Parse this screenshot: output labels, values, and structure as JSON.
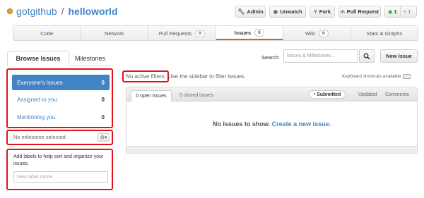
{
  "repo": {
    "owner": "gotgithub",
    "separator": "/",
    "name": "helloworld",
    "icon": "repo-icon"
  },
  "header_buttons": {
    "admin": {
      "label": "Admin",
      "icon": "wrench-icon"
    },
    "unwatch": {
      "label": "Unwatch",
      "icon": "eye-icon"
    },
    "fork": {
      "label": "Fork",
      "icon": "fork-icon"
    },
    "pull_request": {
      "label": "Pull Request",
      "icon": "pull-request-icon"
    },
    "watchers": {
      "count": "1",
      "icon": "eye-icon"
    },
    "forks": {
      "count": "1",
      "icon": "fork-icon"
    }
  },
  "tabs": [
    {
      "label": "Code",
      "badge": ""
    },
    {
      "label": "Network",
      "badge": ""
    },
    {
      "label": "Pull Requests",
      "badge": "0"
    },
    {
      "label": "Issues",
      "badge": "0"
    },
    {
      "label": "Wiki",
      "badge": "0"
    },
    {
      "label": "Stats & Graphs",
      "badge": ""
    }
  ],
  "active_tab": "Issues",
  "subnav": {
    "browse_label": "Browse Issues",
    "milestones_label": "Milestones",
    "search_label": "Search:",
    "search_placeholder": "Issues & Milestones...",
    "new_issue_label": "New Issue"
  },
  "sidebar": {
    "filters": [
      {
        "label": "Everyone's Issues",
        "count": "0",
        "selected": true
      },
      {
        "label": "Assigned to you",
        "count": "0",
        "selected": false
      },
      {
        "label": "Mentioning you",
        "count": "0",
        "selected": false
      }
    ],
    "milestone_label": "No milestone selected",
    "labels_help": "Add labels to help sort and organize your issues.",
    "label_placeholder": "New label name"
  },
  "main": {
    "filters_status": "No active filters.",
    "filters_hint": "Use the sidebar to filter issues.",
    "keyboard_hint": "Keyboard shortcuts available",
    "open_tab": "0 open issues",
    "closed_tab": "0 closed issues",
    "sort_options": [
      "Submitted",
      "Updated",
      "Comments"
    ],
    "empty_text": "No issues to show.",
    "empty_link": "Create a new issue."
  },
  "colors": {
    "link": "#4183c4",
    "selected": "#4183c4",
    "highlight_box": "#e0121b",
    "active_tab_accent": "#d26911"
  }
}
